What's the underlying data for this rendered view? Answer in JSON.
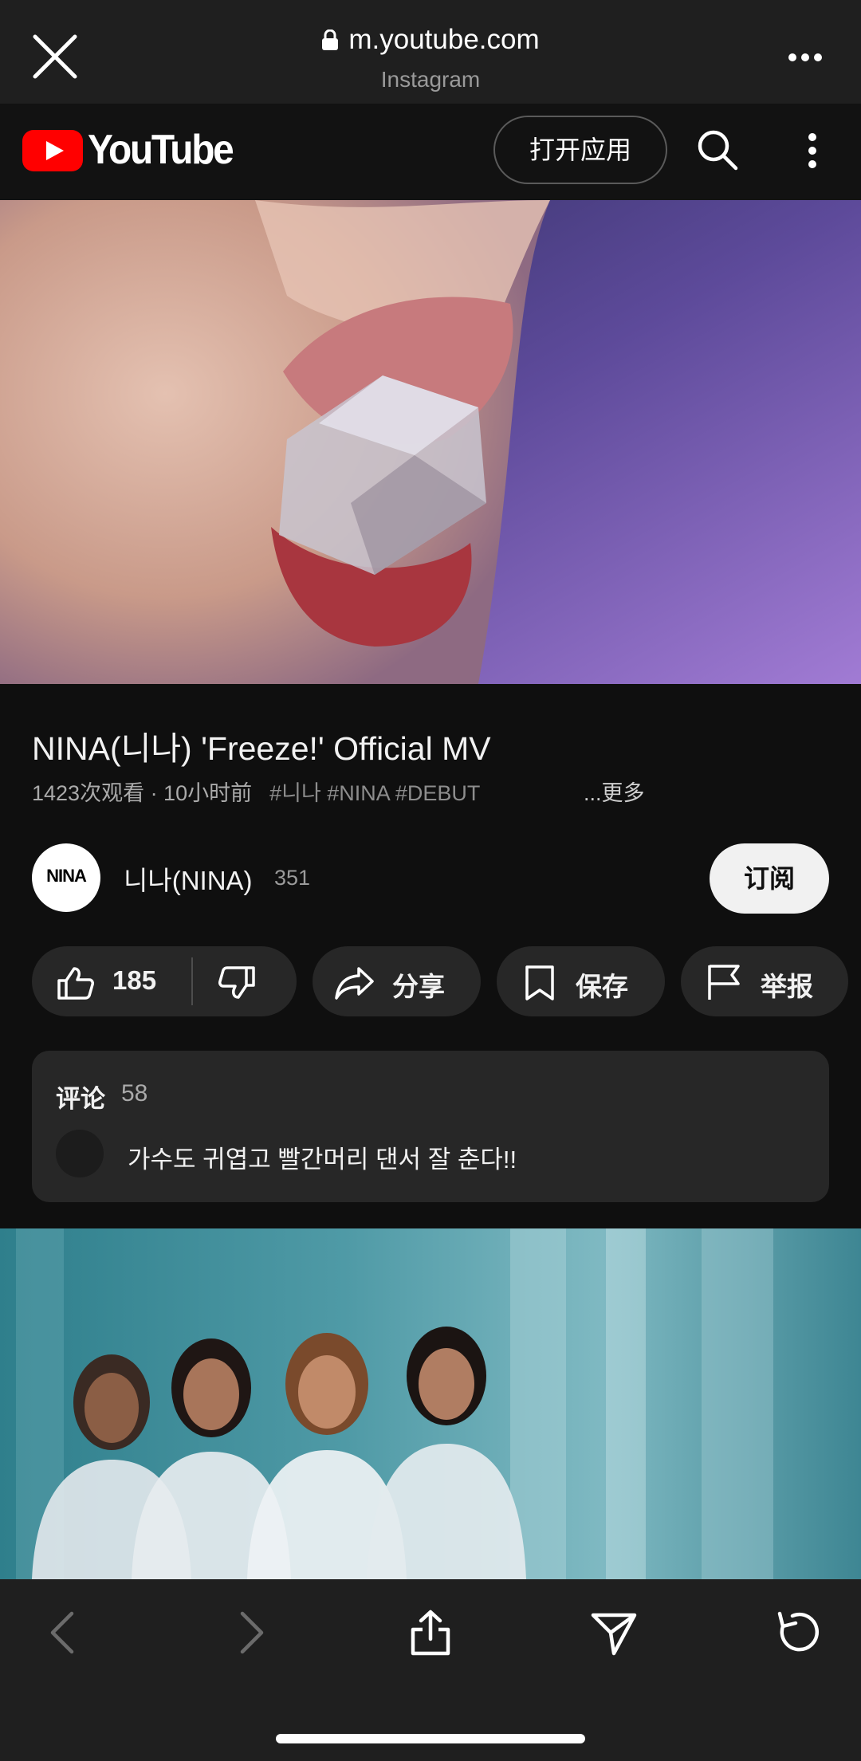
{
  "browser": {
    "url": "m.youtube.com",
    "source": "Instagram"
  },
  "youtube": {
    "wordmark": "YouTube",
    "open_app_label": "打开应用"
  },
  "video": {
    "title": "NINA(니나) 'Freeze!' Official MV",
    "views_time": "1423次观看 · 10小时前",
    "tags": "#니나 #NINA #DEBUT",
    "more_label": "...更多"
  },
  "channel": {
    "avatar_text": "NINA",
    "name": "니나(NINA)",
    "subscribers": "351",
    "subscribe_label": "订阅"
  },
  "actions": {
    "likes": "185",
    "share_label": "分享",
    "save_label": "保存",
    "report_label": "举报"
  },
  "comments": {
    "label": "评论",
    "count": "58",
    "top_comment": "가수도 귀엽고 빨간머리 댄서 잘 춘다!!"
  },
  "colors": {
    "yt_red": "#ff0000",
    "background": "#0f0f0f",
    "pill": "#272727"
  },
  "icons": [
    "close-icon",
    "lock-icon",
    "more-horizontal-icon",
    "youtube-logo",
    "search-icon",
    "more-vertical-icon",
    "like-icon",
    "dislike-icon",
    "share-icon",
    "save-icon",
    "report-flag-icon",
    "back-icon",
    "forward-icon",
    "upload-share-icon",
    "send-icon",
    "reload-icon"
  ]
}
